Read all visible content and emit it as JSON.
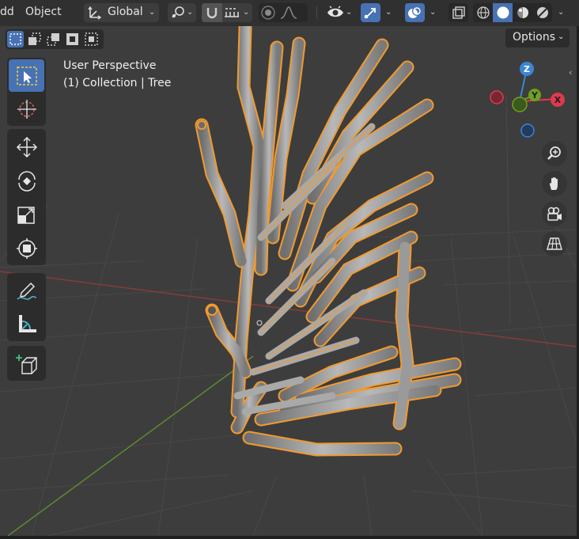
{
  "header": {
    "menu_add_fragment": "dd",
    "menu_object": "Object",
    "transform_orientation": "Global"
  },
  "viewport": {
    "overlay_line1": "User Perspective",
    "overlay_line2": "(1) Collection | Tree",
    "options_label": "Options"
  },
  "gizmo": {
    "z_label": "Z",
    "y_label": "Y",
    "x_label": "X",
    "colors": {
      "x": "#e0394e",
      "y": "#6ea11e",
      "z": "#3b86d4"
    }
  },
  "toolbar": {
    "tools": [
      "select-box",
      "cursor",
      "move",
      "rotate",
      "scale",
      "transform",
      "annotate",
      "measure",
      "add-cube"
    ],
    "active_tool": "select-box"
  },
  "navigation": [
    "zoom",
    "pan",
    "camera",
    "perspective-toggle"
  ],
  "shading": {
    "active": "solid"
  }
}
